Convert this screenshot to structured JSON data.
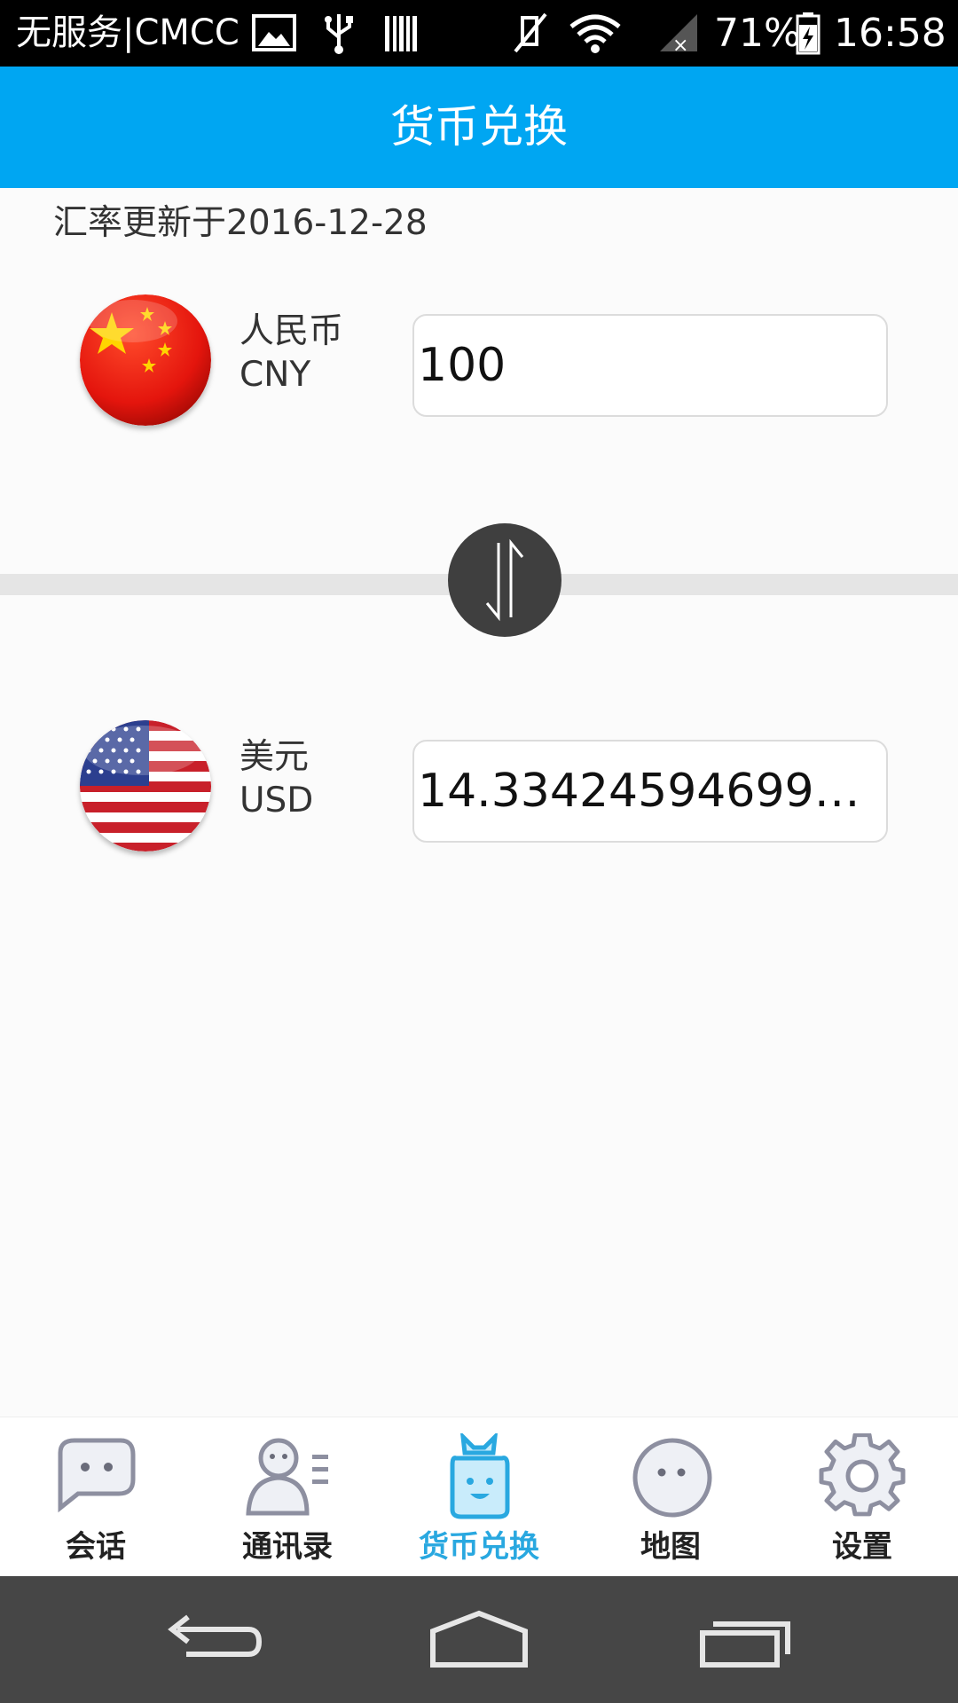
{
  "status_bar": {
    "carrier": "无服务|CMCC",
    "battery_percent": "71%",
    "time": "16:58"
  },
  "title": "货币兑换",
  "rate_updated": "汇率更新于2016-12-28",
  "from_currency": {
    "name": "人民币",
    "code": "CNY",
    "amount": "100",
    "flag_icon": "china-flag-icon"
  },
  "to_currency": {
    "name": "美元",
    "code": "USD",
    "amount": "14.3342459469919...",
    "flag_icon": "usa-flag-icon"
  },
  "bottom_nav": {
    "items": [
      {
        "label": "会话",
        "icon": "chat-icon"
      },
      {
        "label": "通讯录",
        "icon": "contacts-icon"
      },
      {
        "label": "货币兑换",
        "icon": "currency-bag-icon",
        "active": true
      },
      {
        "label": "地图",
        "icon": "map-face-icon"
      },
      {
        "label": "设置",
        "icon": "gear-icon"
      }
    ]
  },
  "colors": {
    "accent": "#00a6f2",
    "active_nav": "#29a8e0"
  }
}
